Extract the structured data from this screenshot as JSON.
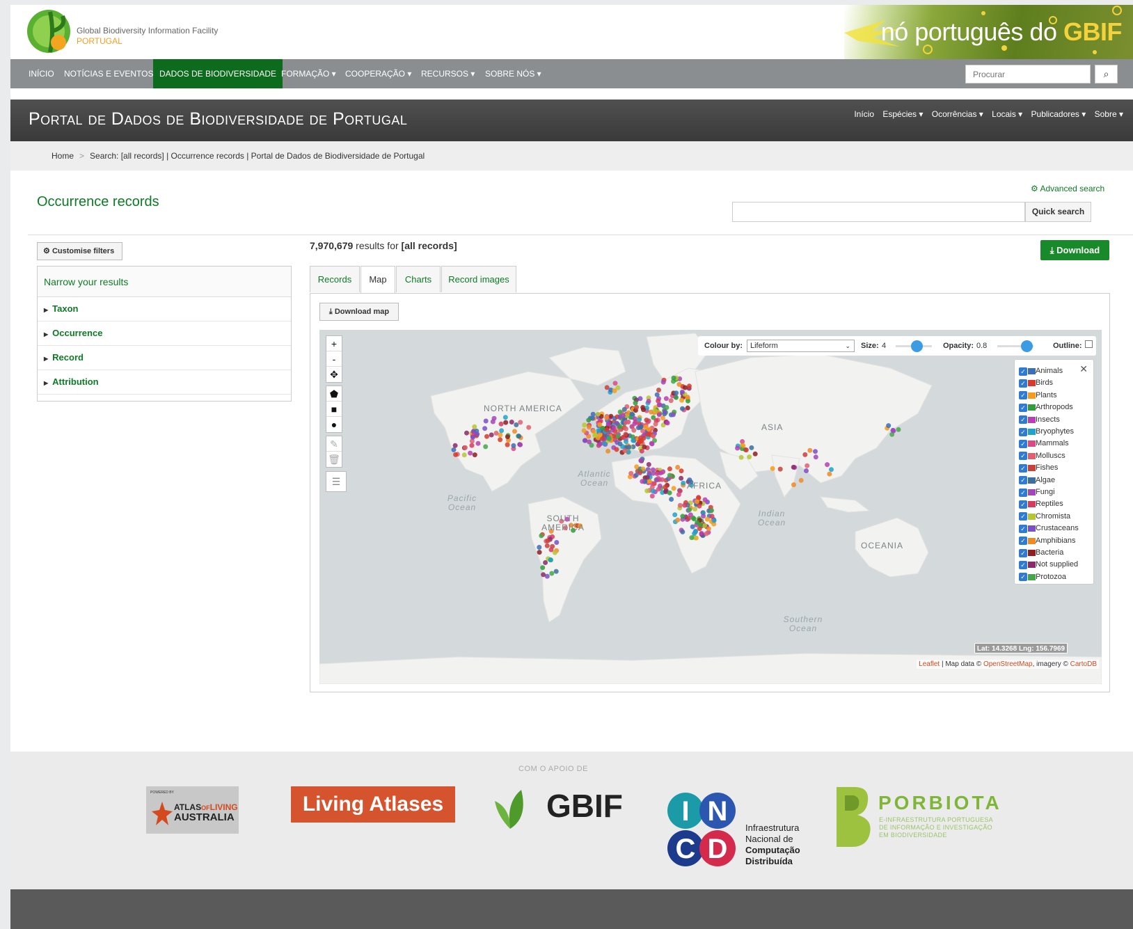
{
  "header": {
    "org_name": "Global Biodiversity Information Facility",
    "org_country": "PORTUGAL",
    "banner_text": "nó português do",
    "banner_brand": "GBIF"
  },
  "main_nav": {
    "items": [
      "INÍCIO",
      "NOTÍCIAS E EVENTOS",
      "DADOS DE BIODIVERSIDADE",
      "FORMAÇÃO ▾",
      "COOPERAÇÃO ▾",
      "RECURSOS ▾",
      "SOBRE NÓS ▾"
    ],
    "search_placeholder": "Procurar"
  },
  "portal": {
    "title": "Portal de Dados de Biodiversidade de Portugal",
    "nav": [
      "Início",
      "Espécies ▾",
      "Ocorrências ▾",
      "Locais ▾",
      "Publicadores ▾",
      "Sobre ▾"
    ]
  },
  "breadcrumb": {
    "home": "Home",
    "current": "Search: [all records] | Occurrence records | Portal de Dados de Biodiversidade de Portugal"
  },
  "page": {
    "title": "Occurrence records",
    "advanced_search": "Advanced search",
    "quick_search": "Quick search",
    "customise_filters": "Customise filters",
    "results_count": "7,970,679",
    "results_mid": " results for ",
    "results_query": "[all records]",
    "download": "Download"
  },
  "filters": {
    "heading": "Narrow your results",
    "items": [
      "Taxon",
      "Occurrence",
      "Record",
      "Attribution"
    ]
  },
  "tabs": [
    "Records",
    "Map",
    "Charts",
    "Record images"
  ],
  "active_tab": "Map",
  "map": {
    "download_map": "Download map",
    "colour_by_label": "Colour by:",
    "colour_by_value": "Lifeform",
    "size_label": "Size:",
    "size_value": "4",
    "opacity_label": "Opacity:",
    "opacity_value": "0.8",
    "outline_label": "Outline:",
    "latlng": "Lat: 14.3268 Lng: 156.7969",
    "attribution_leaflet": "Leaflet",
    "attribution_mid": " | Map data © ",
    "attribution_osm": "OpenStreetMap",
    "attribution_imagery": ", imagery © ",
    "attribution_cartodb": "CartoDB",
    "continents": [
      "NORTH AMERICA",
      "SOUTH AMERICA",
      "AFRICA",
      "ASIA",
      "OCEANIA"
    ],
    "oceans": [
      "Atlantic Ocean",
      "Pacific Ocean",
      "Indian Ocean",
      "Southern Ocean"
    ],
    "legend": [
      {
        "name": "Animals",
        "color": "#3b6fb6"
      },
      {
        "name": "Birds",
        "color": "#d9382c"
      },
      {
        "name": "Plants",
        "color": "#f59c1a"
      },
      {
        "name": "Arthropods",
        "color": "#2f9d3a"
      },
      {
        "name": "Insects",
        "color": "#b83fb4"
      },
      {
        "name": "Bryophytes",
        "color": "#1fa3c9"
      },
      {
        "name": "Mammals",
        "color": "#d94a86"
      },
      {
        "name": "Molluscs",
        "color": "#e06070"
      },
      {
        "name": "Fishes",
        "color": "#c8413b"
      },
      {
        "name": "Algae",
        "color": "#3d6f9e"
      },
      {
        "name": "Fungi",
        "color": "#a347b8"
      },
      {
        "name": "Reptiles",
        "color": "#d63b5f"
      },
      {
        "name": "Chromista",
        "color": "#b6c632"
      },
      {
        "name": "Crustaceans",
        "color": "#7b4fc8"
      },
      {
        "name": "Amphibians",
        "color": "#f08a24"
      },
      {
        "name": "Bacteria",
        "color": "#8e1f1f"
      },
      {
        "name": "Not supplied",
        "color": "#8a2a6a"
      },
      {
        "name": "Protozoa",
        "color": "#44a84a"
      }
    ]
  },
  "footer": {
    "caption": "COM O APOIO DE",
    "ala": [
      "POWERED BY",
      "ATLAS",
      "OF",
      "LIVING",
      "AUSTRALIA"
    ],
    "living_atlases": "Living Atlases",
    "gbif": "GBIF",
    "incd": [
      "Infraestrutura",
      "Nacional de",
      "Computação",
      "Distribuída"
    ],
    "porbiota": "PORBIOTA",
    "porbiota_sub": [
      "E-INFRAESTRUTURA PORTUGUESA",
      "DE INFORMAÇÃO E INVESTIGAÇÃO",
      "EM BIODIVERSIDADE"
    ]
  }
}
